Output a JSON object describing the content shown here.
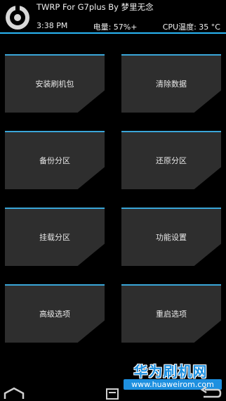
{
  "header": {
    "title": "TWRP For G7plus By 梦里无念",
    "time": "3:38 PM",
    "battery": "电量: 57%+",
    "cpu_temp": "CPU温度: 35 °C"
  },
  "tiles": [
    {
      "label": "安装刷机包"
    },
    {
      "label": "清除数据"
    },
    {
      "label": "备份分区"
    },
    {
      "label": "还原分区"
    },
    {
      "label": "挂载分区"
    },
    {
      "label": "功能设置"
    },
    {
      "label": "高级选项"
    },
    {
      "label": "重启选项"
    }
  ],
  "watermark": {
    "title": "华为刷机网",
    "url": "www.huaweirom.com"
  },
  "nav": {
    "icons": [
      "home-icon",
      "log-icon",
      "back-icon"
    ]
  },
  "colors": {
    "accent": "#29b6f6",
    "tile": "#2e2e2e",
    "background": "#000000"
  }
}
